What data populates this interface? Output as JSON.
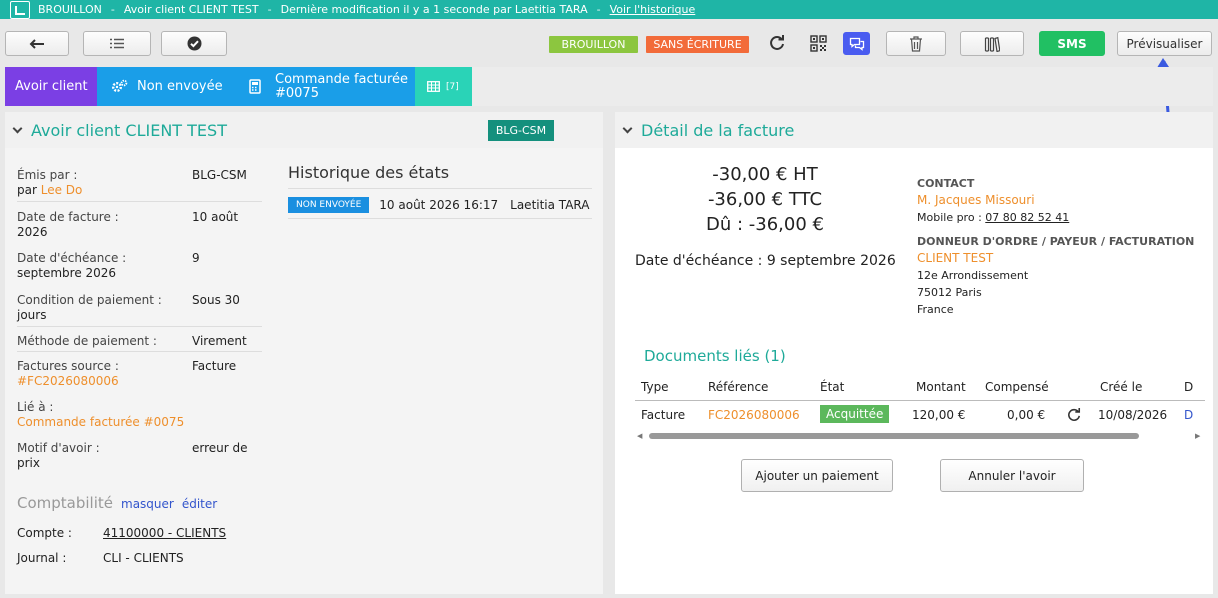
{
  "topbar": {
    "status": "BROUILLON",
    "doc_title": "Avoir client CLIENT TEST",
    "modified": "Dernière modification il y a 1 seconde par Laetitia TARA",
    "history_link": "Voir l'historique"
  },
  "toolbar": {
    "chip_draft": "BROUILLON",
    "chip_no_entry": "SANS ÉCRITURE",
    "sms_label": "SMS",
    "preview_label": "Prévisualiser",
    "colors": {
      "draft": "#8cc63f",
      "no_entry": "#f26b3a",
      "sms": "#21c063",
      "chat": "#4a5cf0"
    }
  },
  "status_tabs": {
    "type_label": "Avoir client",
    "state_label": "Non envoyée",
    "order_label_1": "Commande facturée",
    "order_label_2": "#0075",
    "grid_count": "[7]",
    "colors": {
      "type": "#7b3fe4",
      "state": "#1a9ee8",
      "order": "#1a9ee8",
      "grid": "#2ad3b7"
    }
  },
  "left_panel": {
    "title": "Avoir client CLIENT TEST",
    "badge": "BLG-CSM",
    "fields": {
      "issued_by_label": "Émis par :",
      "issued_by_value": "BLG-CSM",
      "issued_by_person_prefix": "par ",
      "issued_by_person": "Lee Do",
      "invoice_date_label": "Date de facture :",
      "invoice_date_value": "10 août",
      "invoice_date_cont": "2026",
      "due_date_label": "Date d'échéance :",
      "due_date_value": "9",
      "due_date_cont": "septembre 2026",
      "payment_condition_label": "Condition de paiement :",
      "payment_condition_value": "Sous 30",
      "payment_condition_cont": "jours",
      "payment_method_label": "Méthode de paiement :",
      "payment_method_value": "Virement",
      "source_invoices_label": "Factures source :",
      "source_invoices_value": "Facture",
      "source_invoices_cont": "#FC2026080006",
      "linked_label": "Lié à :",
      "linked_value": "Commande facturée #0075",
      "credit_reason_label": "Motif d'avoir :",
      "credit_reason_value": "erreur de",
      "credit_reason_cont": "prix"
    },
    "history": {
      "title": "Historique des états",
      "rows": [
        {
          "state": "NON ENVOYÉE",
          "date": "10 août 2026 16:17",
          "user": "Laetitia TARA"
        }
      ]
    },
    "accounting": {
      "title": "Comptabilité",
      "hide": "masquer",
      "edit": "éditer",
      "account_label": "Compte :",
      "account_value": "41100000 - CLIENTS",
      "journal_label": "Journal :",
      "journal_value": "CLI - CLIENTS"
    }
  },
  "right_panel": {
    "title": "Détail de la facture",
    "total_ht": "-30,00 € HT",
    "total_ttc": "-36,00 € TTC",
    "due": "Dû : -36,00 €",
    "due_date": "Date d'échéance : 9 septembre 2026",
    "contact_heading": "CONTACT",
    "contact_name": "M. Jacques Missouri",
    "contact_mobile_label": "Mobile pro :",
    "contact_mobile": "07 80 82 52 41",
    "client_heading": "DONNEUR D'ORDRE / PAYEUR / FACTURATION",
    "client_name": "CLIENT TEST",
    "address_1": "12e Arrondissement",
    "address_2": "75012 Paris",
    "address_3": "France",
    "linked_docs_title": "Documents liés (1)",
    "table": {
      "headers": [
        "Type",
        "Référence",
        "État",
        "Montant",
        "Compensé",
        "Créé le",
        "D"
      ],
      "row": {
        "type": "Facture",
        "reference": "FC2026080006",
        "state": "Acquittée",
        "amount": "120,00 €",
        "compensated": "0,00 €",
        "created": "10/08/2026",
        "extra": "D"
      }
    },
    "add_payment": "Ajouter un paiement",
    "cancel_credit": "Annuler l'avoir"
  }
}
